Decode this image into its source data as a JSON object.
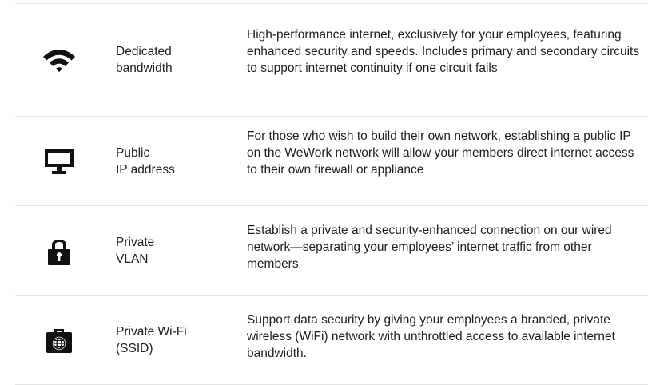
{
  "rows": [
    {
      "icon": "wifi-icon",
      "label": "Dedicated\nbandwidth",
      "description": "High-performance internet, exclusively for your employees, featuring enhanced security and speeds. Includes primary and secondary circuits to support internet continuity if one circuit fails"
    },
    {
      "icon": "monitor-icon",
      "label": "Public\nIP address",
      "description": "For those who wish to build their own network, establishing a public IP on the WeWork network will allow your members direct internet access to their own firewall or appliance"
    },
    {
      "icon": "lock-icon",
      "label": "Private\nVLAN",
      "description": "Establish a private and security-enhanced connection on our wired network—separating your employees’ internet traffic from other members"
    },
    {
      "icon": "globe-case-icon",
      "label": "Private Wi-Fi\n(SSID)",
      "description": "Support data security by giving your employees a branded, private wireless (WiFi) network with unthrottled access to available internet bandwidth."
    }
  ],
  "colors": {
    "text": "#1f1f1f",
    "icon": "#111111",
    "divider": "#e3e3e3"
  }
}
